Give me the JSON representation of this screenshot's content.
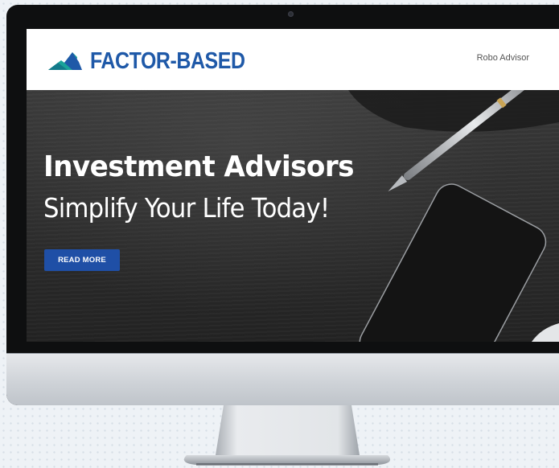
{
  "site": {
    "brand": "FACTOR-BASED",
    "nav_link": "Robo Advisor"
  },
  "hero": {
    "title": "Investment Advisors",
    "subtitle": "Simplify Your Life Today!",
    "cta_label": "READ MORE"
  },
  "colors": {
    "brand_blue": "#1f59a8",
    "logo_teal": "#1aa39a",
    "button_blue": "#1f4fa6",
    "hero_background": "#2c2c2c"
  },
  "icons": {
    "logo_mark": "mountain-logo-icon"
  }
}
